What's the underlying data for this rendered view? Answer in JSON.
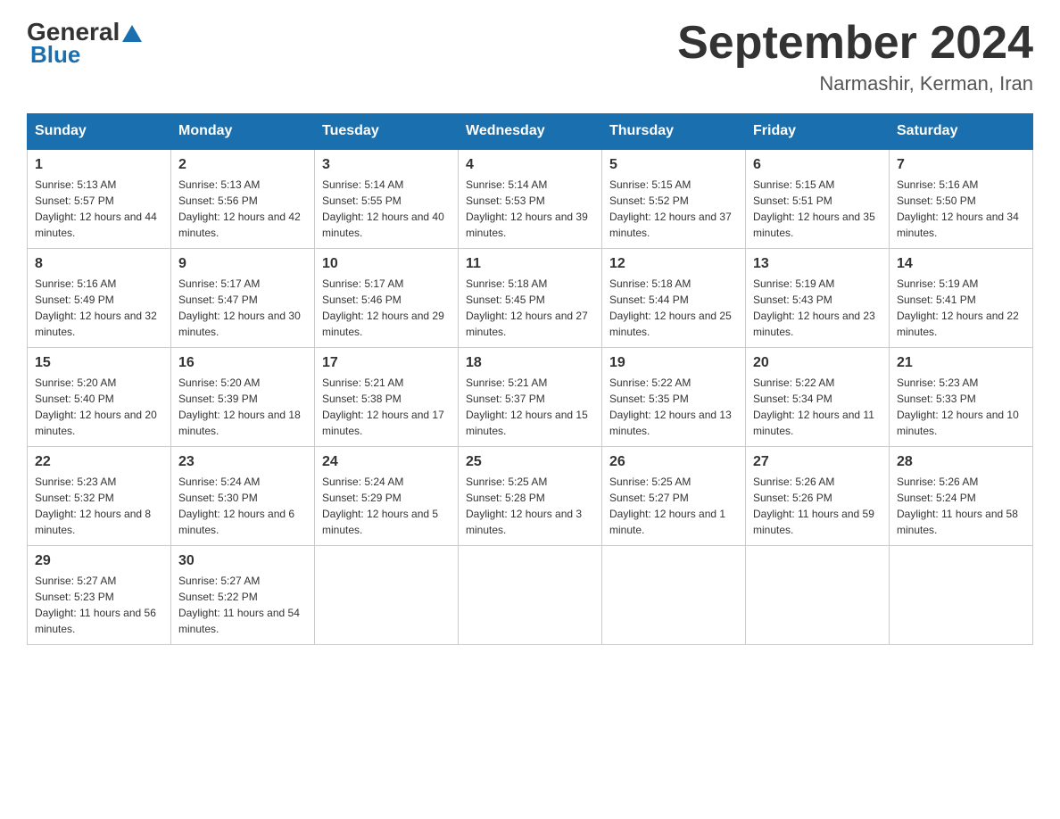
{
  "header": {
    "logo_general": "General",
    "logo_blue": "Blue",
    "month_title": "September 2024",
    "location": "Narmashir, Kerman, Iran"
  },
  "weekdays": [
    "Sunday",
    "Monday",
    "Tuesday",
    "Wednesday",
    "Thursday",
    "Friday",
    "Saturday"
  ],
  "weeks": [
    [
      {
        "day": "1",
        "sunrise": "5:13 AM",
        "sunset": "5:57 PM",
        "daylight": "12 hours and 44 minutes."
      },
      {
        "day": "2",
        "sunrise": "5:13 AM",
        "sunset": "5:56 PM",
        "daylight": "12 hours and 42 minutes."
      },
      {
        "day": "3",
        "sunrise": "5:14 AM",
        "sunset": "5:55 PM",
        "daylight": "12 hours and 40 minutes."
      },
      {
        "day": "4",
        "sunrise": "5:14 AM",
        "sunset": "5:53 PM",
        "daylight": "12 hours and 39 minutes."
      },
      {
        "day": "5",
        "sunrise": "5:15 AM",
        "sunset": "5:52 PM",
        "daylight": "12 hours and 37 minutes."
      },
      {
        "day": "6",
        "sunrise": "5:15 AM",
        "sunset": "5:51 PM",
        "daylight": "12 hours and 35 minutes."
      },
      {
        "day": "7",
        "sunrise": "5:16 AM",
        "sunset": "5:50 PM",
        "daylight": "12 hours and 34 minutes."
      }
    ],
    [
      {
        "day": "8",
        "sunrise": "5:16 AM",
        "sunset": "5:49 PM",
        "daylight": "12 hours and 32 minutes."
      },
      {
        "day": "9",
        "sunrise": "5:17 AM",
        "sunset": "5:47 PM",
        "daylight": "12 hours and 30 minutes."
      },
      {
        "day": "10",
        "sunrise": "5:17 AM",
        "sunset": "5:46 PM",
        "daylight": "12 hours and 29 minutes."
      },
      {
        "day": "11",
        "sunrise": "5:18 AM",
        "sunset": "5:45 PM",
        "daylight": "12 hours and 27 minutes."
      },
      {
        "day": "12",
        "sunrise": "5:18 AM",
        "sunset": "5:44 PM",
        "daylight": "12 hours and 25 minutes."
      },
      {
        "day": "13",
        "sunrise": "5:19 AM",
        "sunset": "5:43 PM",
        "daylight": "12 hours and 23 minutes."
      },
      {
        "day": "14",
        "sunrise": "5:19 AM",
        "sunset": "5:41 PM",
        "daylight": "12 hours and 22 minutes."
      }
    ],
    [
      {
        "day": "15",
        "sunrise": "5:20 AM",
        "sunset": "5:40 PM",
        "daylight": "12 hours and 20 minutes."
      },
      {
        "day": "16",
        "sunrise": "5:20 AM",
        "sunset": "5:39 PM",
        "daylight": "12 hours and 18 minutes."
      },
      {
        "day": "17",
        "sunrise": "5:21 AM",
        "sunset": "5:38 PM",
        "daylight": "12 hours and 17 minutes."
      },
      {
        "day": "18",
        "sunrise": "5:21 AM",
        "sunset": "5:37 PM",
        "daylight": "12 hours and 15 minutes."
      },
      {
        "day": "19",
        "sunrise": "5:22 AM",
        "sunset": "5:35 PM",
        "daylight": "12 hours and 13 minutes."
      },
      {
        "day": "20",
        "sunrise": "5:22 AM",
        "sunset": "5:34 PM",
        "daylight": "12 hours and 11 minutes."
      },
      {
        "day": "21",
        "sunrise": "5:23 AM",
        "sunset": "5:33 PM",
        "daylight": "12 hours and 10 minutes."
      }
    ],
    [
      {
        "day": "22",
        "sunrise": "5:23 AM",
        "sunset": "5:32 PM",
        "daylight": "12 hours and 8 minutes."
      },
      {
        "day": "23",
        "sunrise": "5:24 AM",
        "sunset": "5:30 PM",
        "daylight": "12 hours and 6 minutes."
      },
      {
        "day": "24",
        "sunrise": "5:24 AM",
        "sunset": "5:29 PM",
        "daylight": "12 hours and 5 minutes."
      },
      {
        "day": "25",
        "sunrise": "5:25 AM",
        "sunset": "5:28 PM",
        "daylight": "12 hours and 3 minutes."
      },
      {
        "day": "26",
        "sunrise": "5:25 AM",
        "sunset": "5:27 PM",
        "daylight": "12 hours and 1 minute."
      },
      {
        "day": "27",
        "sunrise": "5:26 AM",
        "sunset": "5:26 PM",
        "daylight": "11 hours and 59 minutes."
      },
      {
        "day": "28",
        "sunrise": "5:26 AM",
        "sunset": "5:24 PM",
        "daylight": "11 hours and 58 minutes."
      }
    ],
    [
      {
        "day": "29",
        "sunrise": "5:27 AM",
        "sunset": "5:23 PM",
        "daylight": "11 hours and 56 minutes."
      },
      {
        "day": "30",
        "sunrise": "5:27 AM",
        "sunset": "5:22 PM",
        "daylight": "11 hours and 54 minutes."
      },
      null,
      null,
      null,
      null,
      null
    ]
  ],
  "labels": {
    "sunrise_prefix": "Sunrise: ",
    "sunset_prefix": "Sunset: ",
    "daylight_prefix": "Daylight: "
  }
}
